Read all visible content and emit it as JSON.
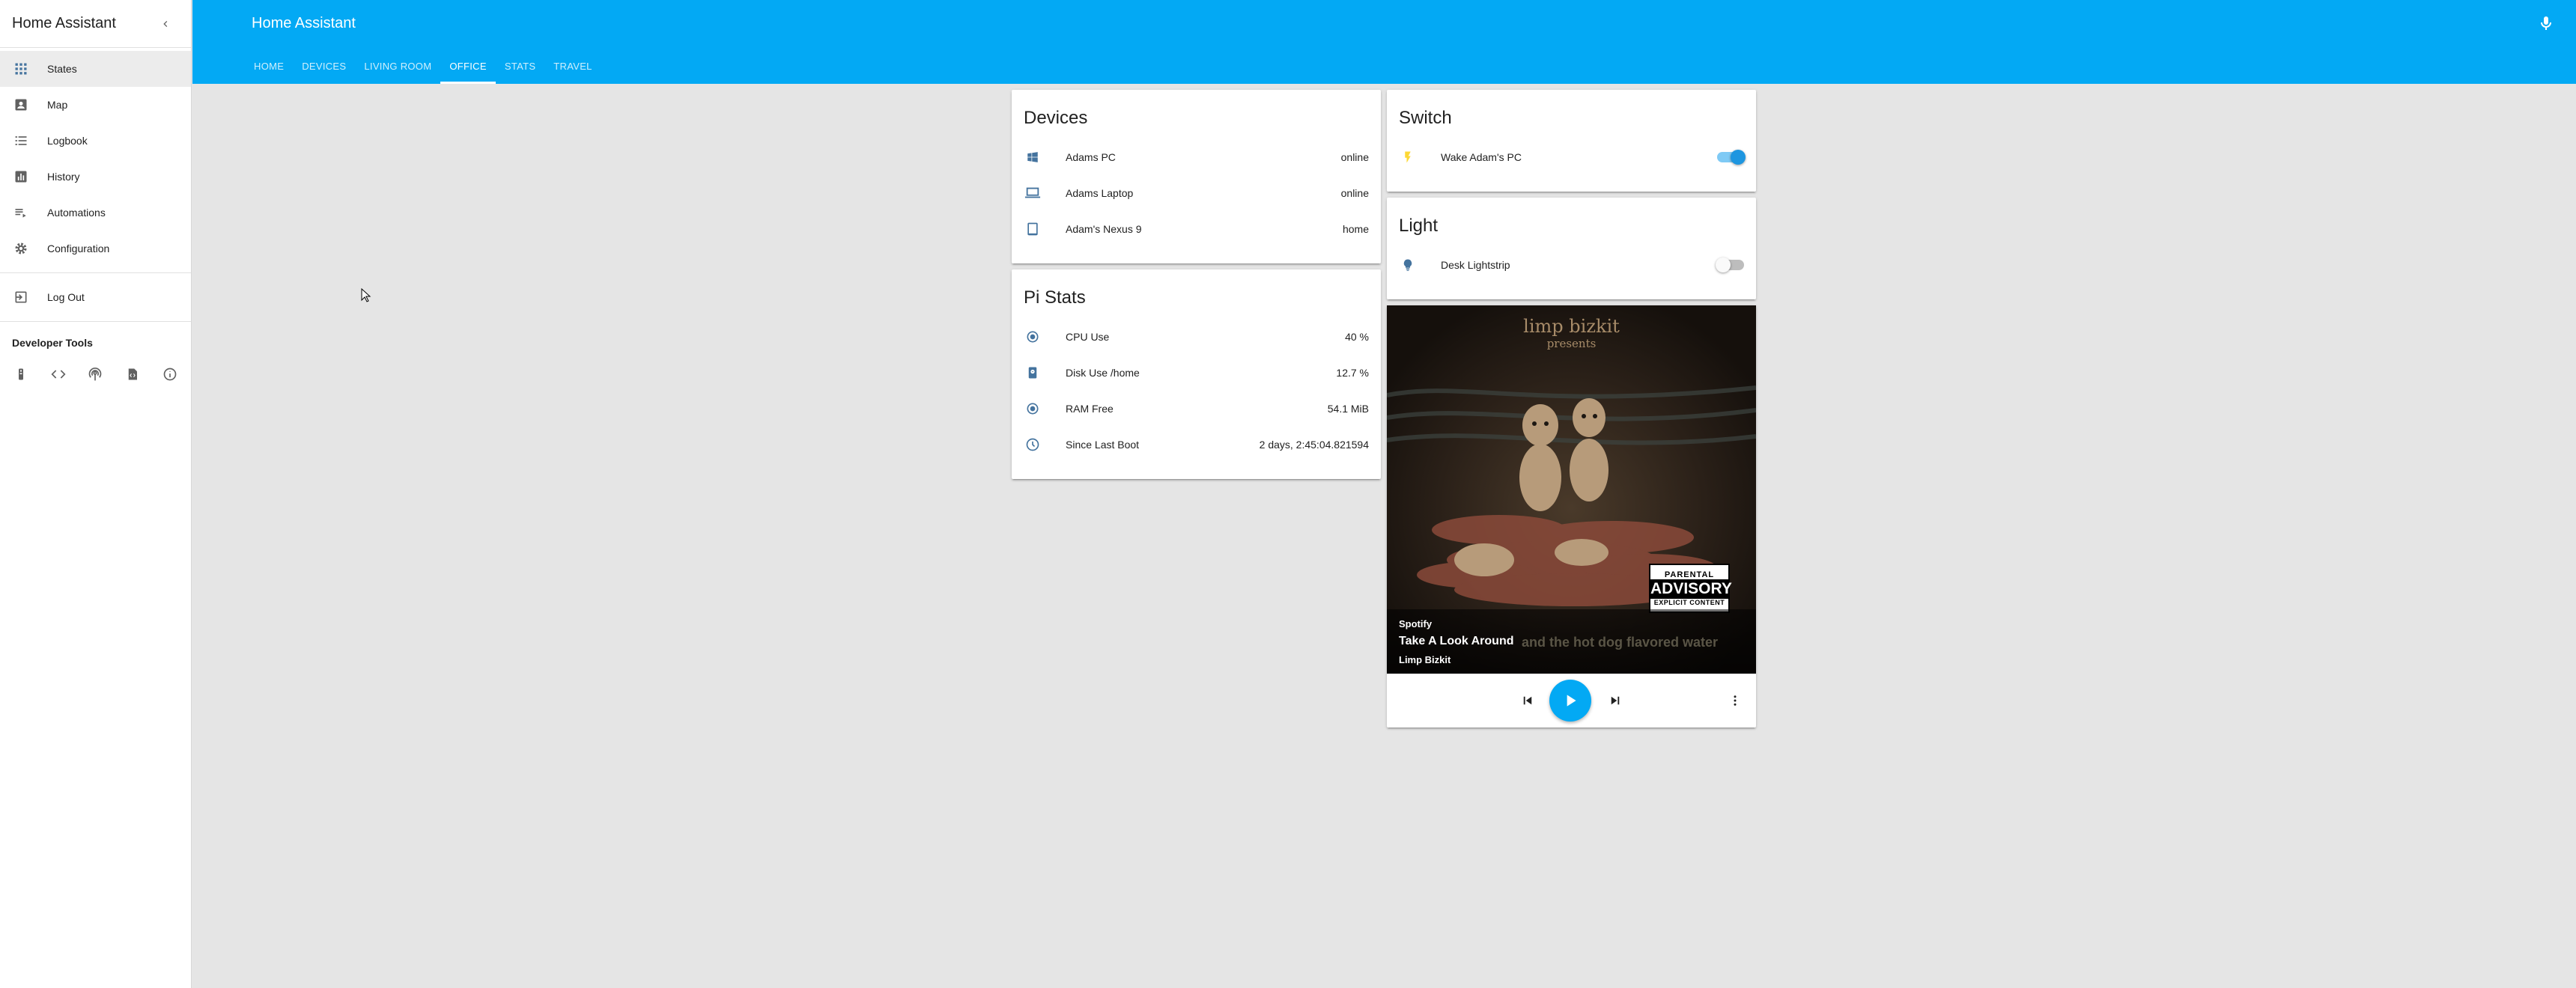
{
  "sidebar": {
    "title": "Home Assistant",
    "items": [
      {
        "label": "States",
        "icon": "grid-icon"
      },
      {
        "label": "Map",
        "icon": "account-box-icon"
      },
      {
        "label": "Logbook",
        "icon": "list-icon"
      },
      {
        "label": "History",
        "icon": "chart-icon"
      },
      {
        "label": "Automations",
        "icon": "playlist-play-icon"
      },
      {
        "label": "Configuration",
        "icon": "settings-icon"
      }
    ],
    "logout": "Log Out",
    "dev_title": "Developer Tools"
  },
  "header": {
    "title": "Home Assistant",
    "tabs": [
      "HOME",
      "DEVICES",
      "LIVING ROOM",
      "OFFICE",
      "STATS",
      "TRAVEL"
    ],
    "active_tab": "OFFICE"
  },
  "devices": {
    "title": "Devices",
    "rows": [
      {
        "name": "Adams PC",
        "state": "online"
      },
      {
        "name": "Adams Laptop",
        "state": "online"
      },
      {
        "name": "Adam's Nexus 9",
        "state": "home"
      }
    ]
  },
  "pistats": {
    "title": "Pi Stats",
    "rows": [
      {
        "name": "CPU Use",
        "state": "40 %"
      },
      {
        "name": "Disk Use /home",
        "state": "12.7 %"
      },
      {
        "name": "RAM Free",
        "state": "54.1 MiB"
      },
      {
        "name": "Since Last Boot",
        "state": "2 days, 2:45:04.821594"
      }
    ]
  },
  "switch": {
    "title": "Switch",
    "rows": [
      {
        "name": "Wake Adam's PC",
        "on": true
      }
    ]
  },
  "light": {
    "title": "Light",
    "rows": [
      {
        "name": "Desk Lightstrip",
        "on": false
      }
    ]
  },
  "media": {
    "band": "limp bizkit",
    "presents": "presents",
    "advisory_top": "PARENTAL",
    "advisory_mid": "ADVISORY",
    "advisory_bottom": "EXPLICIT CONTENT",
    "source": "Spotify",
    "title": "Take A Look Around",
    "title_ghost": "and the hot dog flavored water",
    "artist": "Limp Bizkit"
  },
  "colors": {
    "primary": "#03a9f4",
    "switch_icon": "#fdd835",
    "entity_icon": "#44739e"
  }
}
